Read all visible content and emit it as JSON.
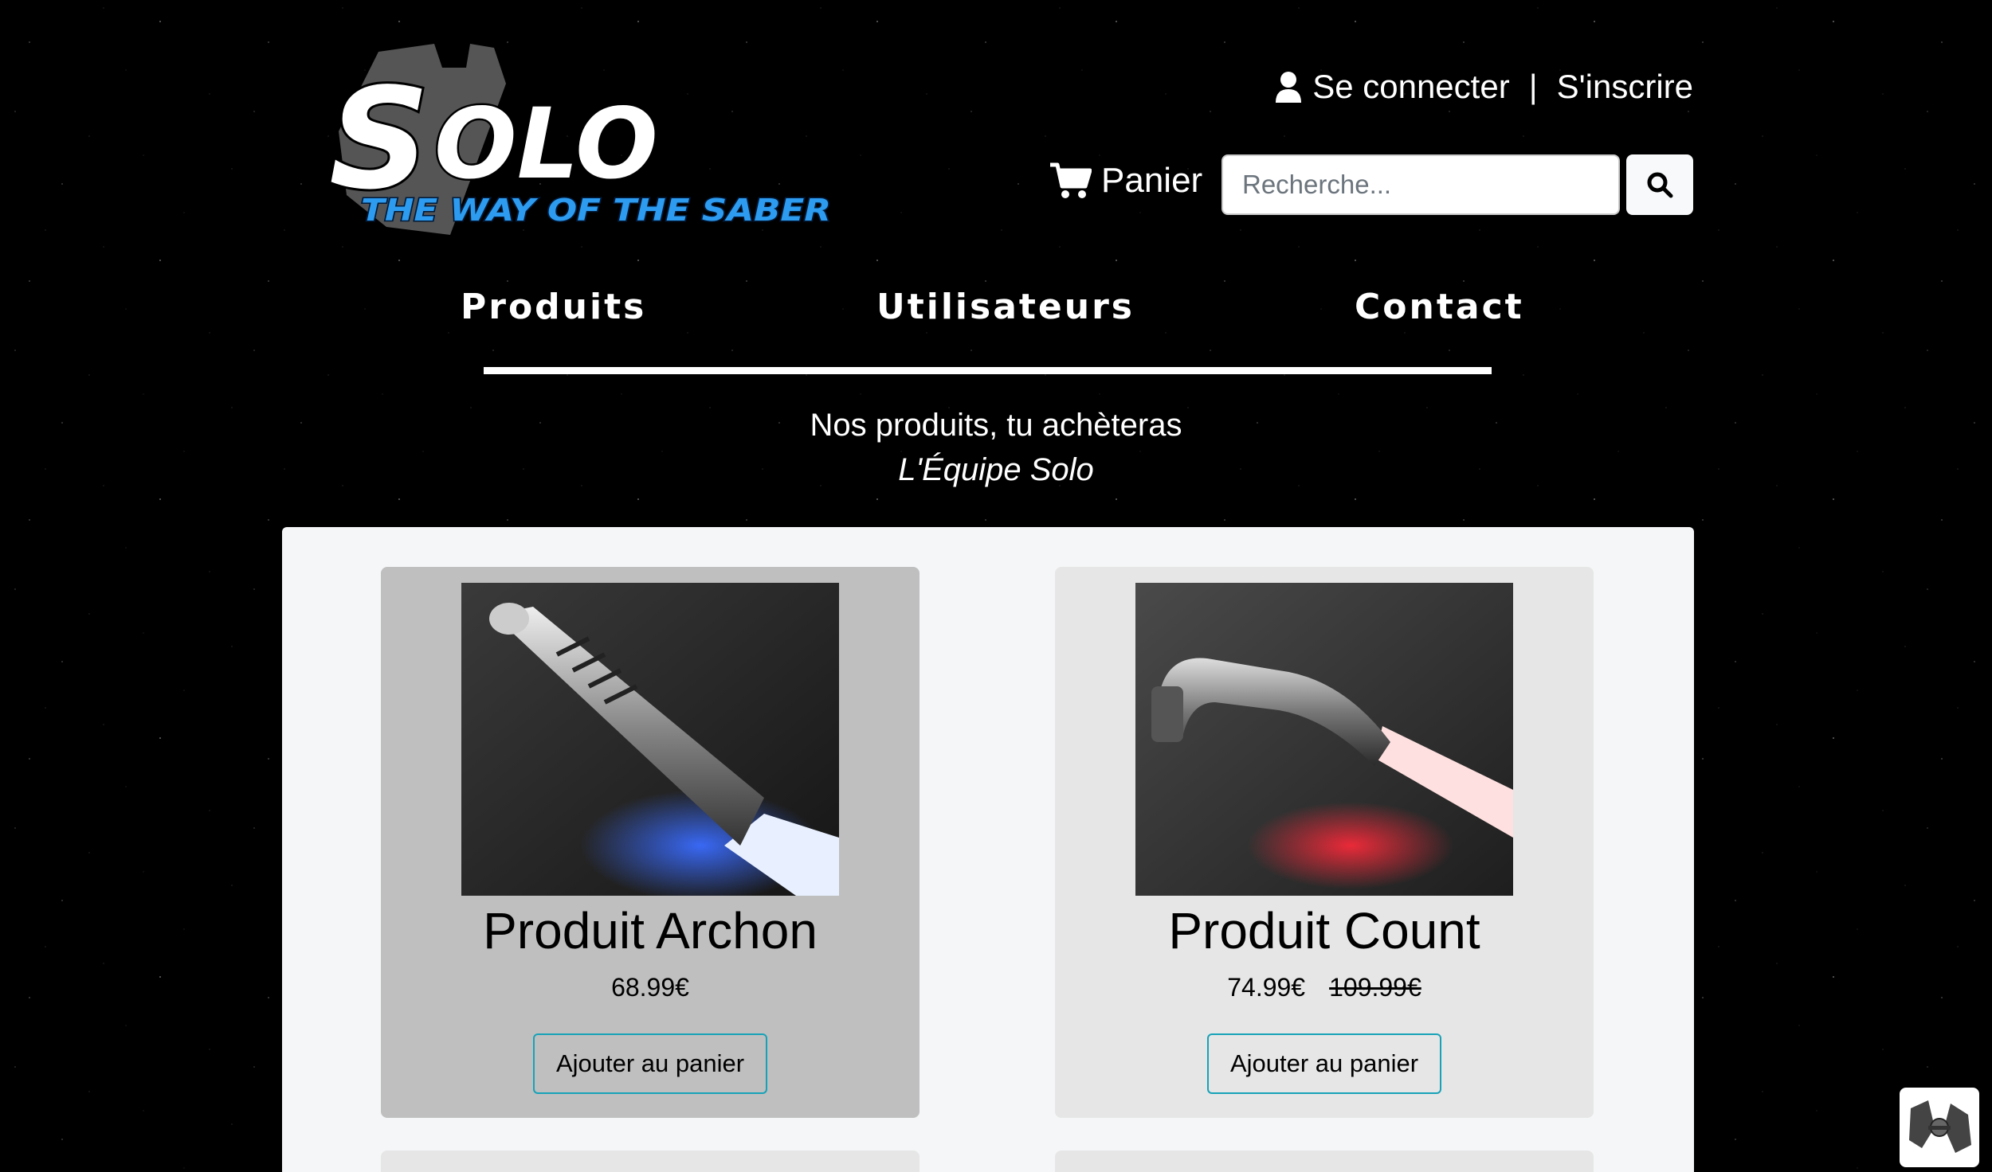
{
  "header": {
    "logo_text": "Solo",
    "logo_tagline": "THE WAY OF THE SABER",
    "login_label": "Se connecter",
    "separator": "|",
    "signup_label": "S'inscrire",
    "cart_label": "Panier",
    "search_placeholder": "Recherche..."
  },
  "nav": {
    "items": [
      {
        "label": "Produits"
      },
      {
        "label": "Utilisateurs"
      },
      {
        "label": "Contact"
      }
    ]
  },
  "tagline": {
    "quote": "Nos produits, tu achèteras",
    "author": "L'Équipe Solo"
  },
  "products": [
    {
      "name": "Produit Archon",
      "price": "68.99€",
      "old_price": "",
      "button_label": "Ajouter au panier",
      "blade_color": "#3a6cff"
    },
    {
      "name": "Produit Count",
      "price": "74.99€",
      "old_price": "109.99€",
      "button_label": "Ajouter au panier",
      "blade_color": "#ff2a3a"
    }
  ],
  "colors": {
    "accent_blue": "#2d9cf0",
    "button_border": "#17a2b8"
  }
}
